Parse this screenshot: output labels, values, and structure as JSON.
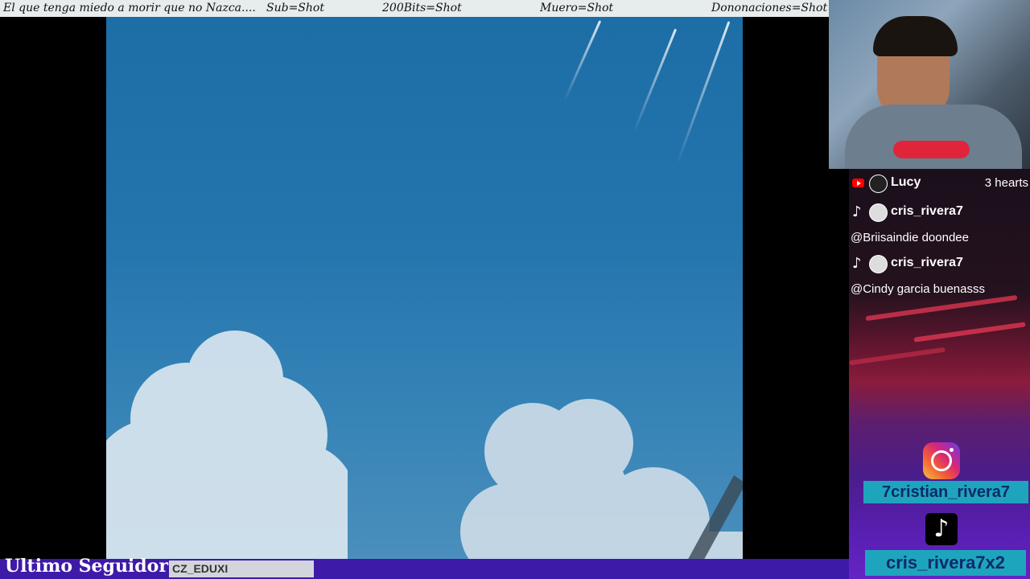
{
  "ticker": [
    "El que tenga miedo a morir que no Nazca....",
    "Sub=Shot",
    "200Bits=Shot",
    "Muero=Shot",
    "Dononaciones=Shot"
  ],
  "chat": [
    {
      "platform": "youtube-icon",
      "name": "Lucy",
      "meta": "3 hearts"
    },
    {
      "platform": "tiktok-icon",
      "name": "cris_rivera7",
      "message": "@Briisaindie doondee"
    },
    {
      "platform": "tiktok-icon",
      "name": "cris_rivera7",
      "message": "@Cindy garcia buenasss"
    }
  ],
  "socials": {
    "instagram": "7cristian_rivera7",
    "tiktok": "cris_rivera7x2"
  },
  "bottom": {
    "label": "Ultimo Seguidor",
    "follower": "CZ_EDUXI"
  },
  "colors": {
    "sky": "#2474ad",
    "bottom_bar": "#3e1aa8",
    "handle_bg": "#1ea5bd",
    "handle_text": "#0d2a6a"
  }
}
